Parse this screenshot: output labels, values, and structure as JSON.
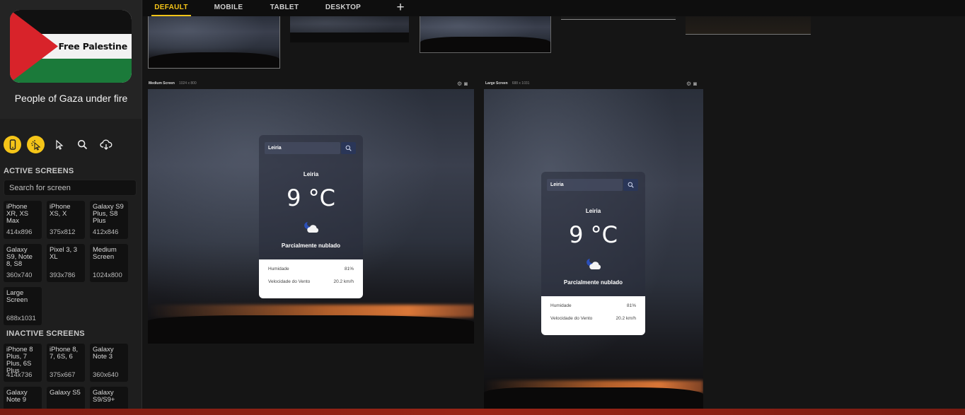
{
  "sidebar": {
    "banner": {
      "flag_text": "Free Palestine",
      "caption": "People of Gaza under fire"
    },
    "tools": [
      {
        "icon": "phone-touch-icon",
        "active": true
      },
      {
        "icon": "cursor-sparkle-icon",
        "active": true
      },
      {
        "icon": "cursor-icon",
        "active": false
      },
      {
        "icon": "search-icon",
        "active": false
      },
      {
        "icon": "cloud-download-icon",
        "active": false
      }
    ],
    "active_title": "ACTIVE SCREENS",
    "search_placeholder": "Search for screen",
    "active_screens": [
      {
        "name": "iPhone XR, XS Max",
        "res": "414x896"
      },
      {
        "name": "iPhone XS, X",
        "res": "375x812"
      },
      {
        "name": "Galaxy S9 Plus, S8 Plus",
        "res": "412x846"
      },
      {
        "name": "Galaxy S9, Note 8, S8",
        "res": "360x740"
      },
      {
        "name": "Pixel 3, 3 XL",
        "res": "393x786"
      },
      {
        "name": "Medium Screen",
        "res": "1024x800"
      },
      {
        "name": "Large Screen",
        "res": "688x1031"
      }
    ],
    "inactive_title": "INACTIVE SCREENS",
    "inactive_screens": [
      {
        "name": "iPhone 8 Plus, 7 Plus, 6S Plus",
        "res": "414x736"
      },
      {
        "name": "iPhone 8, 7, 6S, 6",
        "res": "375x667"
      },
      {
        "name": "Galaxy Note 3",
        "res": "360x640"
      },
      {
        "name": "Galaxy Note 9",
        "res": ""
      },
      {
        "name": "Galaxy S5",
        "res": ""
      },
      {
        "name": "Galaxy S9/S9+",
        "res": ""
      }
    ]
  },
  "tabs": [
    {
      "label": "DEFAULT",
      "active": true
    },
    {
      "label": "MOBILE",
      "active": false
    },
    {
      "label": "TABLET",
      "active": false
    },
    {
      "label": "DESKTOP",
      "active": false
    }
  ],
  "tab_add": "+",
  "screens": {
    "medium": {
      "label": "Medium Screen",
      "dims": "1024 x 800"
    },
    "large": {
      "label": "Large Screen",
      "dims": "688 x 1031"
    }
  },
  "weather": {
    "search_value": "Leiria",
    "city": "Leiria",
    "temp": "9 °C",
    "description": "Parcialmente nublado",
    "humidity_label": "Humidade",
    "humidity_value": "81%",
    "wind_label": "Velocidade do Vento",
    "wind_value": "20.2 km/h"
  },
  "colors": {
    "accent": "#f5c518",
    "sidebar_bg": "#1e1e1e",
    "canvas_bg": "#151515",
    "bottom_bar": "#9a2416"
  }
}
